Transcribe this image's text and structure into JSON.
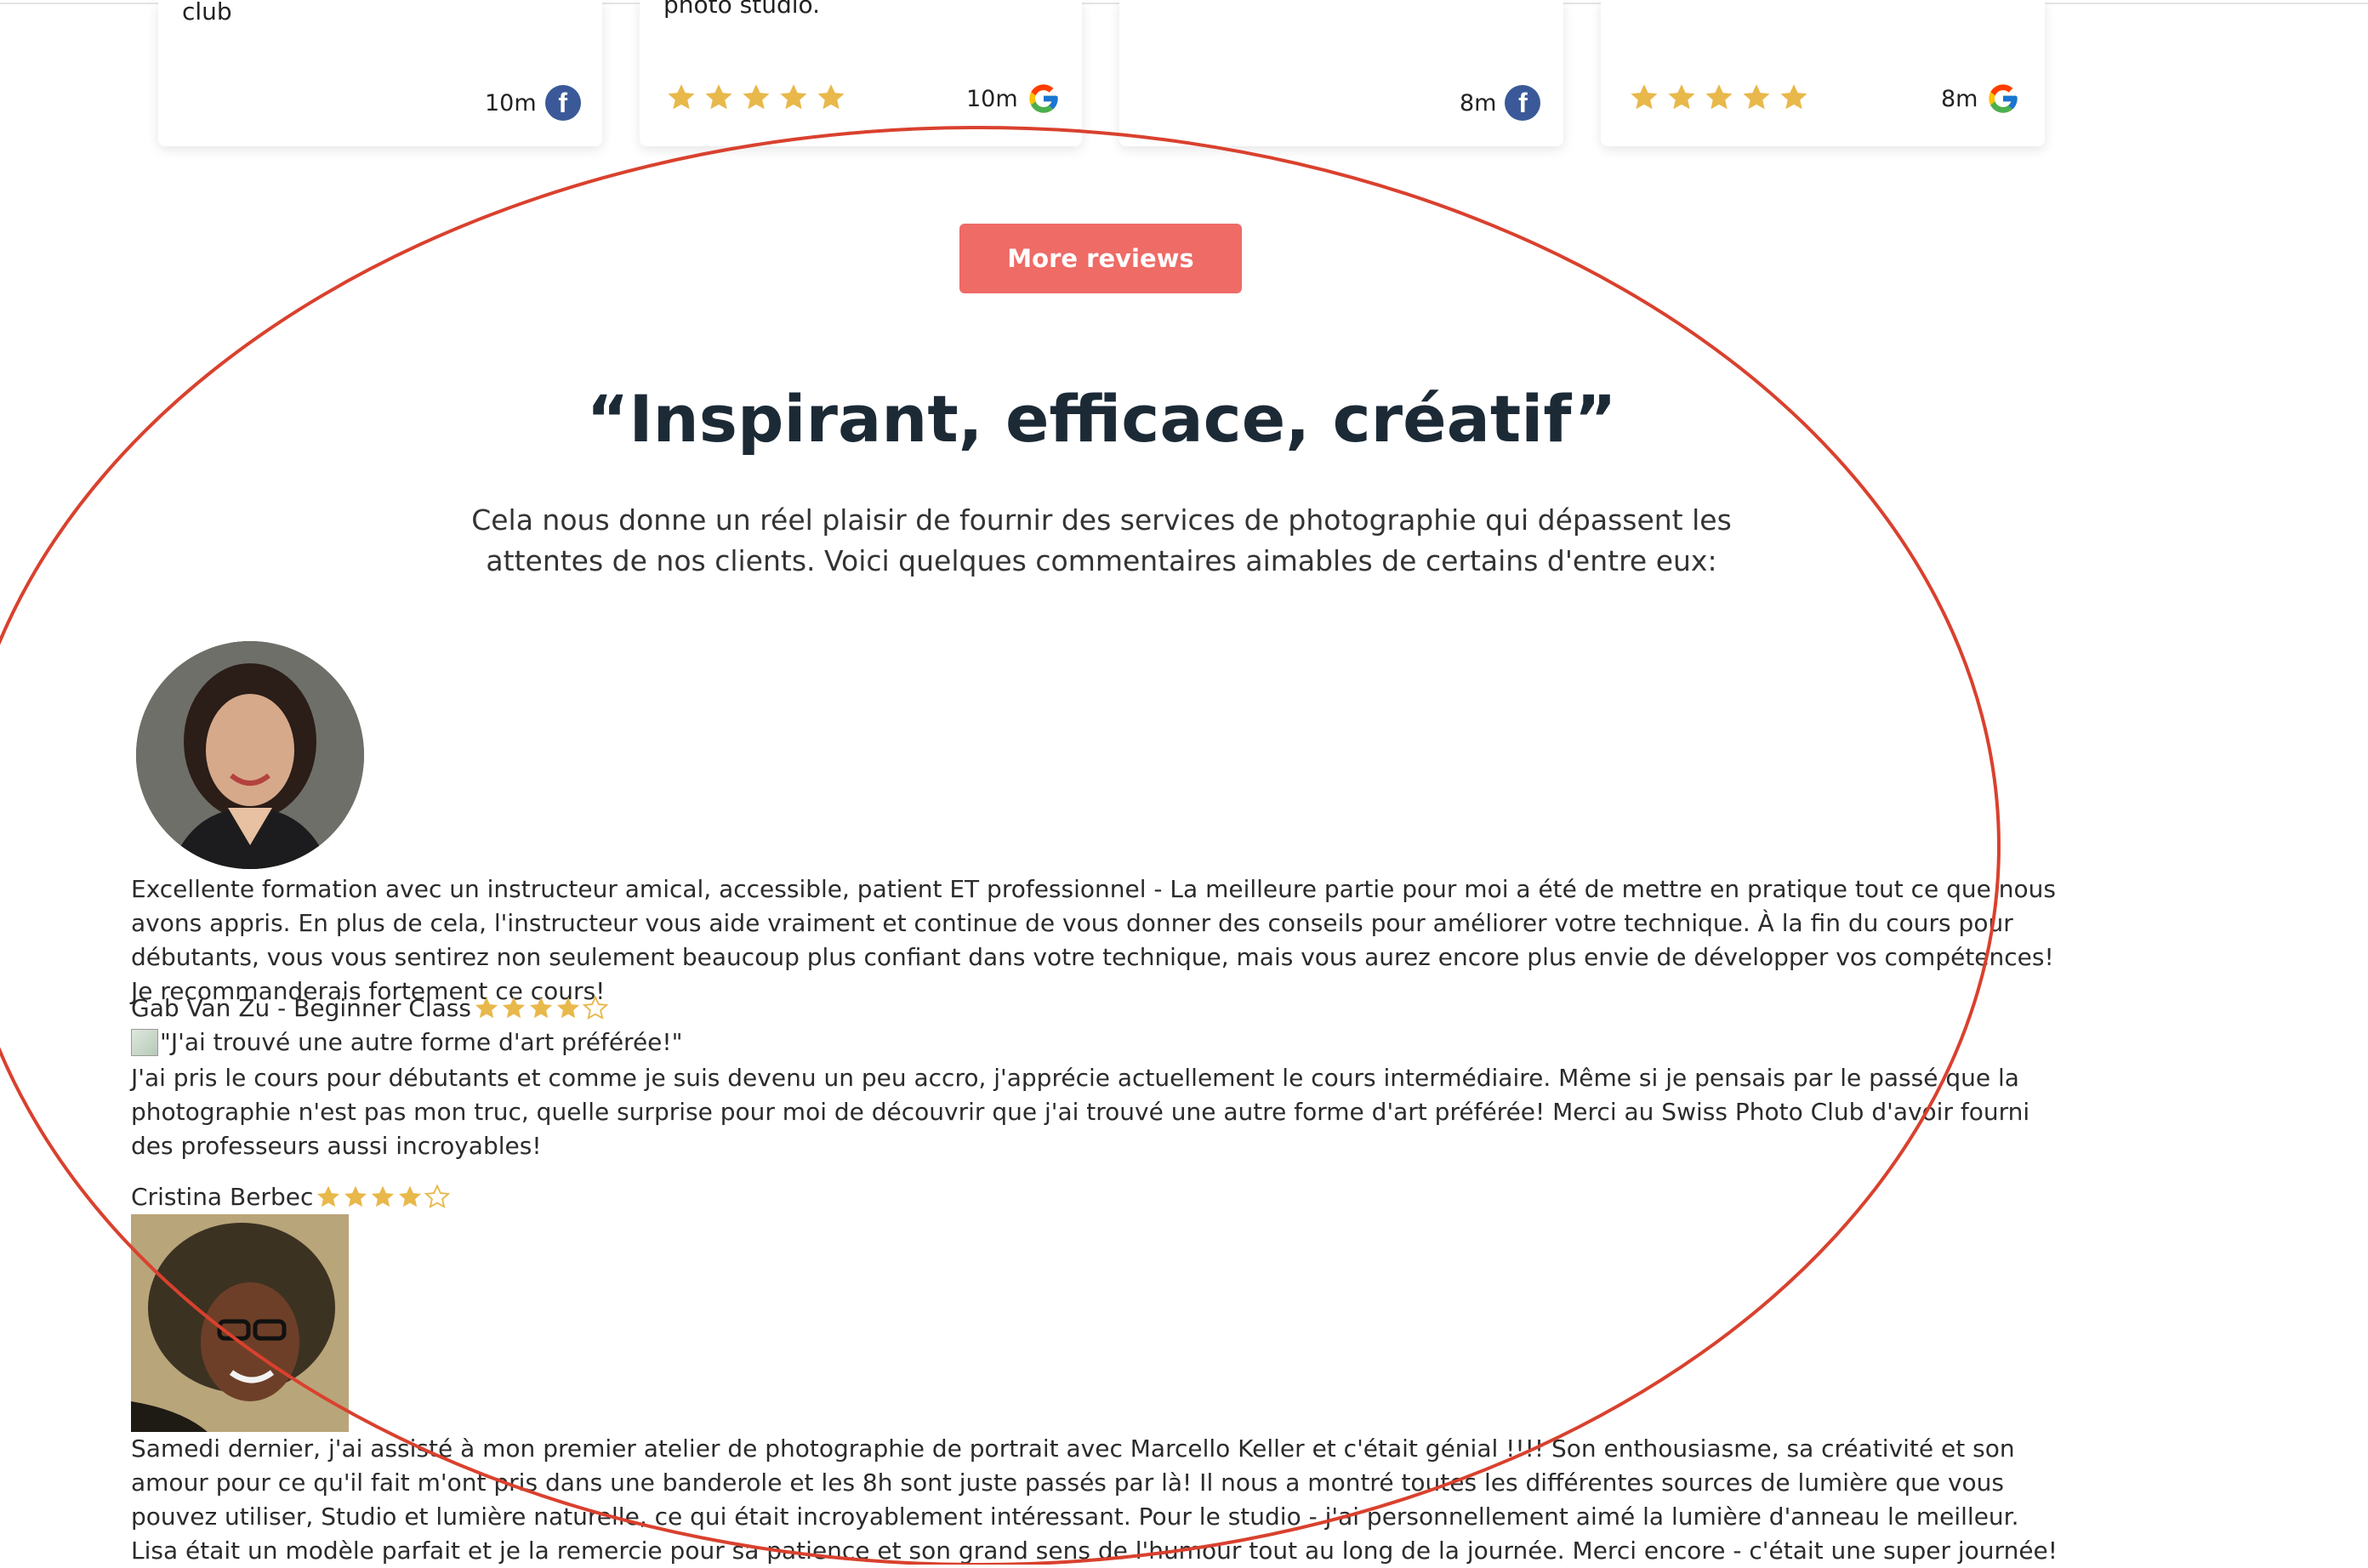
{
  "reviews_row": [
    {
      "text": "club",
      "stars": 0,
      "time": "10m",
      "source": "facebook"
    },
    {
      "text": "photo studio.",
      "stars": 5,
      "time": "10m",
      "source": "google"
    },
    {
      "text": "",
      "stars": 0,
      "time": "8m",
      "source": "facebook"
    },
    {
      "text": "",
      "stars": 5,
      "time": "8m",
      "source": "google"
    }
  ],
  "more_reviews_label": "More reviews",
  "title": "“Inspirant, efficace, créatif”",
  "subtitle": "Cela nous donne un réel plaisir de fournir des services de photographie qui dépassent les attentes de nos clients. Voici quelques commentaires aimables de certains d'entre eux:",
  "testimonials": [
    {
      "text": "Excellente formation avec un instructeur amical, accessible, patient ET professionnel - La meilleure partie pour moi a été de mettre en pratique tout ce que nous avons appris. En plus de cela, l'instructeur vous aide vraiment et continue de vous donner des conseils pour améliorer votre technique. À la fin du cours pour débutants, vous vous sentirez non seulement beaucoup plus confiant dans votre technique, mais vous aurez encore plus envie de développer vos compétences! Je recommanderais fortement ce cours!",
      "author": "Gab Van Zu - Beginner Class",
      "rating": 4
    },
    {
      "image_alt": "\"J'ai trouvé une autre forme d'art préférée!\"",
      "text": "J'ai pris le cours pour débutants et comme je suis devenu un peu accro, j'apprécie actuellement le cours intermédiaire. Même si je pensais par le passé que la photographie n'est pas mon truc, quelle surprise pour moi de découvrir que j'ai trouvé une autre forme d'art préférée! Merci au Swiss Photo Club d'avoir fourni des professeurs aussi incroyables!",
      "author": "Cristina Berbec",
      "rating": 4
    },
    {
      "text": "Samedi dernier, j'ai assisté à mon premier atelier de photographie de portrait avec Marcello Keller et c'était génial !!!! Son enthousiasme, sa créativité et son amour pour ce qu'il fait m'ont pris dans une banderole et les 8h sont juste passés par là! Il nous a montré toutes les différentes sources de lumière que vous pouvez utiliser, Studio et lumière naturelle, ce qui était incroyablement intéressant. Pour le studio - j'ai personnellement aimé la lumière d'anneau le meilleur. Lisa était un modèle parfait et je la remercie pour sa patience et son grand sens de l'humour tout au long de la journée. Merci encore - c'était une super journée!"
    }
  ],
  "colors": {
    "accent": "#ee6b66",
    "star": "#e8b84a",
    "annotation": "#d9412e",
    "heading": "#1c2a36",
    "facebook": "#3b5998"
  }
}
